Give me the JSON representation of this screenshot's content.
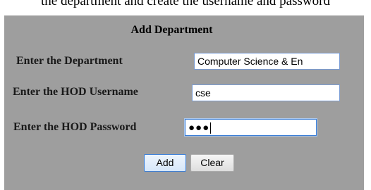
{
  "caption": "the department and create the username and password",
  "form": {
    "title": "Add Department",
    "department": {
      "label": "Enter the Department",
      "value": "Computer Science & En"
    },
    "username": {
      "label": "Enter the HOD Username",
      "value": "cse"
    },
    "password": {
      "label": "Enter the HOD Password",
      "masked_value": "●●●"
    },
    "buttons": {
      "add": "Add",
      "clear": "Clear"
    }
  },
  "colors": {
    "panel_background": "#9e9e9e",
    "focus_border": "#3c7fd6"
  }
}
